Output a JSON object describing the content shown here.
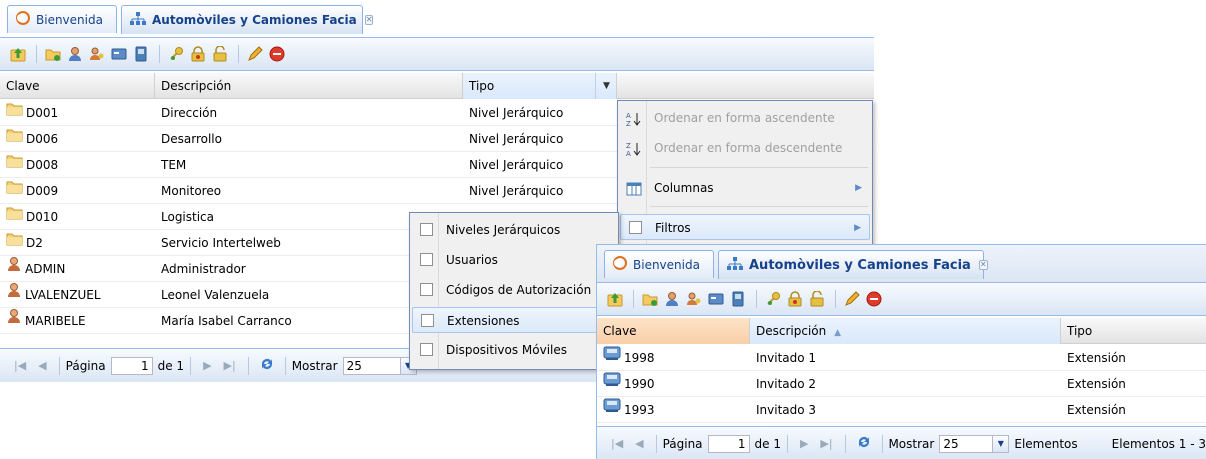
{
  "win1": {
    "tabs": [
      {
        "label": "Bienvenida"
      },
      {
        "label": "Automòviles y Camiones Facia"
      }
    ],
    "toolbar_icons": [
      "upload-icon",
      "folder-add-icon",
      "user-icon",
      "users-key-icon",
      "card-icon",
      "phone-icon",
      "lock-key-icon",
      "lock-icon",
      "lock-open-icon",
      "edit-icon",
      "delete-icon"
    ],
    "columns": [
      "Clave",
      "Descripción",
      "Tipo"
    ],
    "rows": [
      {
        "icon": "folder",
        "clave": "D001",
        "desc": "Dirección",
        "tipo": "Nivel Jerárquico"
      },
      {
        "icon": "folder",
        "clave": "D006",
        "desc": "Desarrollo",
        "tipo": "Nivel Jerárquico"
      },
      {
        "icon": "folder",
        "clave": "D008",
        "desc": "TEM",
        "tipo": "Nivel Jerárquico"
      },
      {
        "icon": "folder",
        "clave": "D009",
        "desc": "Monitoreo",
        "tipo": "Nivel Jerárquico"
      },
      {
        "icon": "folder",
        "clave": "D010",
        "desc": "Logistica",
        "tipo": ""
      },
      {
        "icon": "folder",
        "clave": "D2",
        "desc": "Servicio Intertelweb",
        "tipo": ""
      },
      {
        "icon": "user",
        "clave": "ADMIN",
        "desc": "Administrador",
        "tipo": ""
      },
      {
        "icon": "user",
        "clave": "LVALENZUEL",
        "desc": "Leonel Valenzuela",
        "tipo": ""
      },
      {
        "icon": "user",
        "clave": "MARIBELE",
        "desc": "María Isabel Carranco",
        "tipo": ""
      }
    ],
    "pager": {
      "page_label": "Página",
      "page_value": "1",
      "of_label": "de 1",
      "show_label": "Mostrar",
      "show_value": "25",
      "elements_label": "Elementos"
    }
  },
  "column_menu": {
    "items": [
      {
        "label": "Ordenar en forma ascendente",
        "icon": "sort-asc-icon",
        "enabled": false
      },
      {
        "label": "Ordenar en forma descendente",
        "icon": "sort-desc-icon",
        "enabled": false
      },
      {
        "label": "Columnas",
        "icon": "columns-icon",
        "enabled": true,
        "submenu": true
      },
      {
        "label": "Filtros",
        "icon": "checkbox",
        "enabled": true,
        "submenu": true
      }
    ]
  },
  "filter_menu": {
    "items": [
      "Niveles Jerárquicos",
      "Usuarios",
      "Códigos de Autorización",
      "Extensiones",
      "Dispositivos Móviles"
    ],
    "highlighted": "Extensiones"
  },
  "win2": {
    "tabs": [
      {
        "label": "Bienvenida"
      },
      {
        "label": "Automòviles y Camiones Facia"
      }
    ],
    "toolbar_icons": [
      "upload-icon",
      "folder-add-icon",
      "user-icon",
      "users-key-icon",
      "card-icon",
      "phone-icon",
      "lock-key-icon",
      "lock-icon",
      "lock-open-icon",
      "edit-icon",
      "delete-icon"
    ],
    "columns": [
      "Clave",
      "Descripción",
      "Tipo"
    ],
    "sort_indicator": "▲",
    "rows": [
      {
        "icon": "phone",
        "clave": "1998",
        "desc": "Invitado 1",
        "tipo": "Extensión"
      },
      {
        "icon": "phone",
        "clave": "1990",
        "desc": "Invitado 2",
        "tipo": "Extensión"
      },
      {
        "icon": "phone",
        "clave": "1993",
        "desc": "Invitado 3",
        "tipo": "Extensión"
      }
    ],
    "pager": {
      "page_label": "Página",
      "page_value": "1",
      "of_label": "de 1",
      "show_label": "Mostrar",
      "show_value": "25",
      "elements_label": "Elementos",
      "range_label": "Elementos 1 - 3"
    }
  },
  "colors": {
    "tab_text": "#15428b",
    "border": "#99bbe8",
    "folder": "#f2c96a",
    "user": "#c46b3c"
  }
}
